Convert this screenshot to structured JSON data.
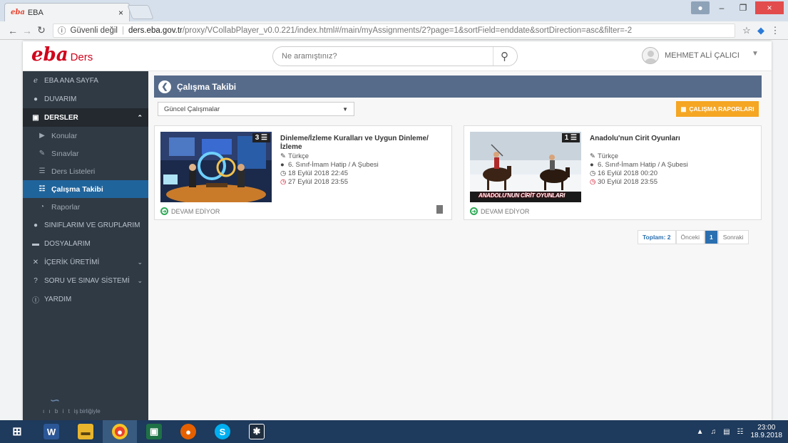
{
  "browser": {
    "tab_title": "EBA",
    "tab_favicon": "eba",
    "tab_close": "×",
    "security": "Güvenli değil",
    "url_host": "ders.eba.gov.tr",
    "url_path": "/proxy/VCollabPlayer_v0.0.221/index.html#/main/myAssignments/2?page=1&sortField=enddate&sortDirection=asc&filter=-2",
    "window_controls": [
      "–",
      "❐",
      "×"
    ]
  },
  "header": {
    "logo_main": "eba",
    "logo_sub": "Ders",
    "search_placeholder": "Ne aramıştınız?",
    "user_name": "MEHMET ALİ ÇALICI"
  },
  "sidebar": {
    "items": [
      {
        "label": "EBA ANA SAYFA",
        "icon": "eba-logo-icon"
      },
      {
        "label": "DUVARIM",
        "icon": "user-icon"
      },
      {
        "label": "DERSLER",
        "icon": "classroom-icon",
        "active": true
      },
      {
        "label": "SINIFLARIM VE GRUPLARIM",
        "icon": "group-icon"
      },
      {
        "label": "DOSYALARIM",
        "icon": "folder-icon"
      },
      {
        "label": "İÇERİK ÜRETİMİ",
        "icon": "tools-icon"
      },
      {
        "label": "SORU VE SINAV SİSTEMİ",
        "icon": "question-icon"
      },
      {
        "label": "YARDIM",
        "icon": "info-icon"
      }
    ],
    "subitems": [
      {
        "label": "Konular",
        "icon": "play-icon"
      },
      {
        "label": "Sınavlar",
        "icon": "pencil-icon"
      },
      {
        "label": "Ders Listeleri",
        "icon": "list-icon"
      },
      {
        "label": "Çalışma Takibi",
        "icon": "tracking-icon",
        "selected": true
      },
      {
        "label": "Raporlar",
        "icon": "pie-chart-icon"
      }
    ],
    "footer_letters": "ı ı b i t",
    "footer_text": "iş birliğiyle"
  },
  "main": {
    "title": "Çalışma Takibi",
    "filter_value": "Güncel Çalışmalar",
    "report_button": "ÇALIŞMA RAPORLARI",
    "cards": [
      {
        "count": "3",
        "title": "Dinleme/İzleme Kuralları ve Uygun Dinleme/ İzleme",
        "subject": "Türkçe",
        "class": "6. Sınıf-İmam Hatip / A Şubesi",
        "start": "18 Eylül 2018 22:45",
        "end": "27 Eylül 2018 23:55",
        "status": "DEVAM EDİYOR"
      },
      {
        "count": "1",
        "title": "Anadolu'nun Cirit Oyunları",
        "subject": "Türkçe",
        "class": "6. Sınıf-İmam Hatip / A Şubesi",
        "start": "16 Eylül 2018 00:20",
        "end": "30 Eylül 2018 23:55",
        "status": "DEVAM EDİYOR",
        "thumb_caption": "ANADOLU'NUN CİRİT OYUNLARI"
      }
    ],
    "pager": {
      "total": "Toplam: 2",
      "prev": "Önceki",
      "current": "1",
      "next": "Sonraki"
    }
  },
  "taskbar": {
    "time": "23:00",
    "date": "18.9.2018"
  }
}
